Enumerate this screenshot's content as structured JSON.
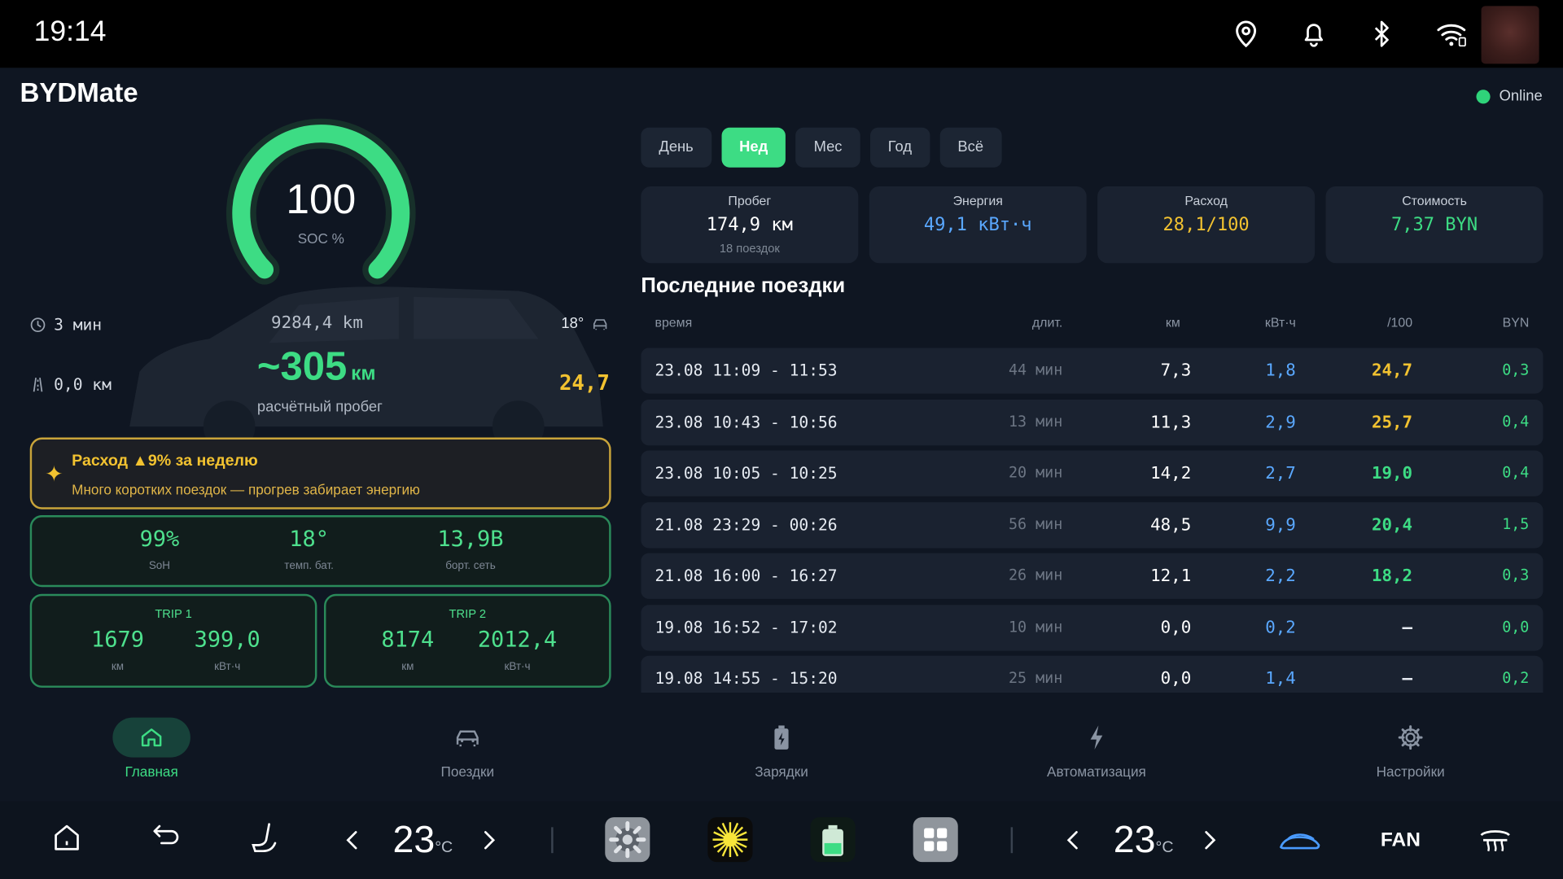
{
  "status_bar": {
    "time": "19:14"
  },
  "app": {
    "title": "BYDMate",
    "status": "Online"
  },
  "gauge": {
    "value": "100",
    "label": "SOC %",
    "fraction": 1.0
  },
  "left": {
    "duration": "3 мин",
    "trip_km": "0,0 км",
    "odometer": "9284,4 km",
    "ambient_temp": "18°",
    "range_value": "~305",
    "range_unit": "км",
    "range_label": "расчётный пробег",
    "consumption": "24,7"
  },
  "alert": {
    "title": "Расход ▲9% за неделю",
    "text": "Много коротких поездок — прогрев забирает энергию"
  },
  "battery": [
    {
      "value": "99%",
      "label": "SoH"
    },
    {
      "value": "18°",
      "label": "темп. бат."
    },
    {
      "value": "13,9В",
      "label": "борт. сеть"
    }
  ],
  "trips": [
    {
      "title": "TRIP 1",
      "km": "1679",
      "km_label": "км",
      "kwh": "399,0",
      "kwh_label": "кВт·ч"
    },
    {
      "title": "TRIP 2",
      "km": "8174",
      "km_label": "км",
      "kwh": "2012,4",
      "kwh_label": "кВт·ч"
    }
  ],
  "period_tabs": [
    "День",
    "Нед",
    "Мес",
    "Год",
    "Всё"
  ],
  "summary": [
    {
      "title": "Пробег",
      "value": "174,9 км",
      "sub": "18 поездок",
      "color": "#ffffff"
    },
    {
      "title": "Энергия",
      "value": "49,1 кВт·ч",
      "sub": "",
      "color": "#5aa8ff"
    },
    {
      "title": "Расход",
      "value": "28,1/100",
      "sub": "",
      "color": "#f2c230"
    },
    {
      "title": "Стоимость",
      "value": "7,37 BYN",
      "sub": "",
      "color": "#3ddc84"
    }
  ],
  "trips_table": {
    "title": "Последние поездки",
    "headers": {
      "time": "время",
      "duration": "длит.",
      "km": "км",
      "kwh": "кВт·ч",
      "per100": "/100",
      "byn": "BYN"
    },
    "rows": [
      {
        "time": "23.08  11:09 - 11:53",
        "duration": "44 мин",
        "km": "7,3",
        "kwh": "1,8",
        "per100": "24,7",
        "byn": "0,3",
        "color": "#f2c230"
      },
      {
        "time": "23.08  10:43 - 10:56",
        "duration": "13 мин",
        "km": "11,3",
        "kwh": "2,9",
        "per100": "25,7",
        "byn": "0,4",
        "color": "#f2c230"
      },
      {
        "time": "23.08  10:05 - 10:25",
        "duration": "20 мин",
        "km": "14,2",
        "kwh": "2,7",
        "per100": "19,0",
        "byn": "0,4",
        "color": "#3ddc84"
      },
      {
        "time": "21.08  23:29 - 00:26",
        "duration": "56 мин",
        "km": "48,5",
        "kwh": "9,9",
        "per100": "20,4",
        "byn": "1,5",
        "color": "#3ddc84"
      },
      {
        "time": "21.08  16:00 - 16:27",
        "duration": "26 мин",
        "km": "12,1",
        "kwh": "2,2",
        "per100": "18,2",
        "byn": "0,3",
        "color": "#3ddc84"
      },
      {
        "time": "19.08  16:52 - 17:02",
        "duration": "10 мин",
        "km": "0,0",
        "kwh": "0,2",
        "per100": "—",
        "byn": "0,0",
        "color": "#e6ebf2"
      },
      {
        "time": "19.08  14:55 - 15:20",
        "duration": "25 мин",
        "km": "0,0",
        "kwh": "1,4",
        "per100": "—",
        "byn": "0,2",
        "color": "#e6ebf2"
      }
    ]
  },
  "bottom_nav": [
    {
      "label": "Главная",
      "icon": "home-icon",
      "active": true
    },
    {
      "label": "Поездки",
      "icon": "car-icon",
      "active": false
    },
    {
      "label": "Зарядки",
      "icon": "battery-charging-icon",
      "active": false
    },
    {
      "label": "Автоматизация",
      "icon": "lightning-icon",
      "active": false
    },
    {
      "label": "Настройки",
      "icon": "gear-icon",
      "active": false
    }
  ],
  "system_bar": {
    "left_temp": "23",
    "right_temp": "23",
    "temp_unit": "°C",
    "fan_label": "FAN"
  },
  "colors": {
    "accent": "#3ddc84",
    "warning": "#f2c230",
    "energy": "#5aa8ff",
    "background": "#0f1622",
    "card": "#1a2230"
  }
}
